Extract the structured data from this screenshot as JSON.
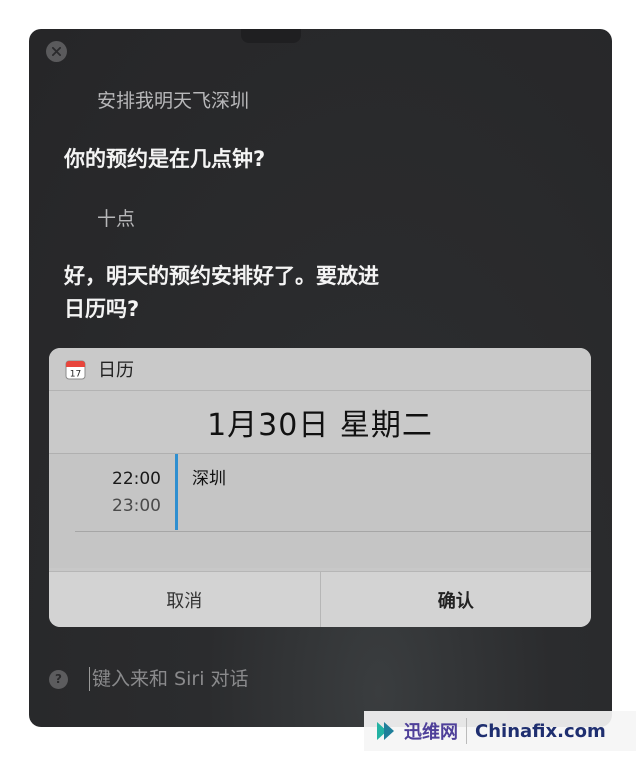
{
  "conversation": {
    "user_request": "安排我明天飞深圳",
    "siri_question": "你的预约是在几点钟?",
    "user_answer": "十点",
    "siri_confirm_line1": "好，明天的预约安排好了。要放进",
    "siri_confirm_line2": "日历吗?"
  },
  "card": {
    "app_name": "日历",
    "app_icon_day": "17",
    "date": "1月30日 星期二",
    "event": {
      "start": "22:00",
      "end": "23:00",
      "title": "深圳"
    },
    "cancel_label": "取消",
    "confirm_label": "确认"
  },
  "input": {
    "placeholder": "键入来和 Siri 对话"
  },
  "icons": {
    "close": "close-icon",
    "calendar": "calendar-icon",
    "help": "help-icon"
  },
  "colors": {
    "event_accent": "#2f8fd0",
    "window_bg": "#262628"
  },
  "watermark": {
    "brand1": "迅维网",
    "brand2": "Chinafix.com"
  }
}
